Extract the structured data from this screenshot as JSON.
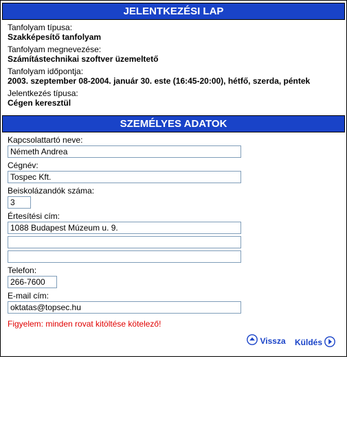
{
  "headers": {
    "registration": "JELENTKEZÉSI LAP",
    "personal": "SZEMÉLYES ADATOK"
  },
  "course": {
    "type_label": "Tanfolyam típusa:",
    "type_value": "Szakképesítő tanfolyam",
    "name_label": "Tanfolyam megnevezése:",
    "name_value": "Számítástechnikai szoftver üzemeltető",
    "date_label": "Tanfolyam időpontja:",
    "date_value": "2003. szeptember 08-2004. január 30. este (16:45-20:00), hétfő, szerda, péntek",
    "regtype_label": "Jelentkezés típusa:",
    "regtype_value": "Cégen keresztül"
  },
  "form": {
    "contact_label": "Kapcsolattartó neve:",
    "contact_value": "Németh Andrea",
    "company_label": "Cégnév:",
    "company_value": "Tospec Kft.",
    "count_label": "Beiskolázandók száma:",
    "count_value": "3",
    "address_label": "Értesítési cím:",
    "address_line1": "1088 Budapest Múzeum u. 9.",
    "address_line2": "",
    "address_line3": "",
    "phone_label": "Telefon:",
    "phone_value": "266-7600",
    "email_label": "E-mail cím:",
    "email_value": "oktatas@topsec.hu"
  },
  "warning": "Figyelem: minden rovat kitöltése kötelező!",
  "footer": {
    "back": "Vissza",
    "send": "Küldés"
  }
}
